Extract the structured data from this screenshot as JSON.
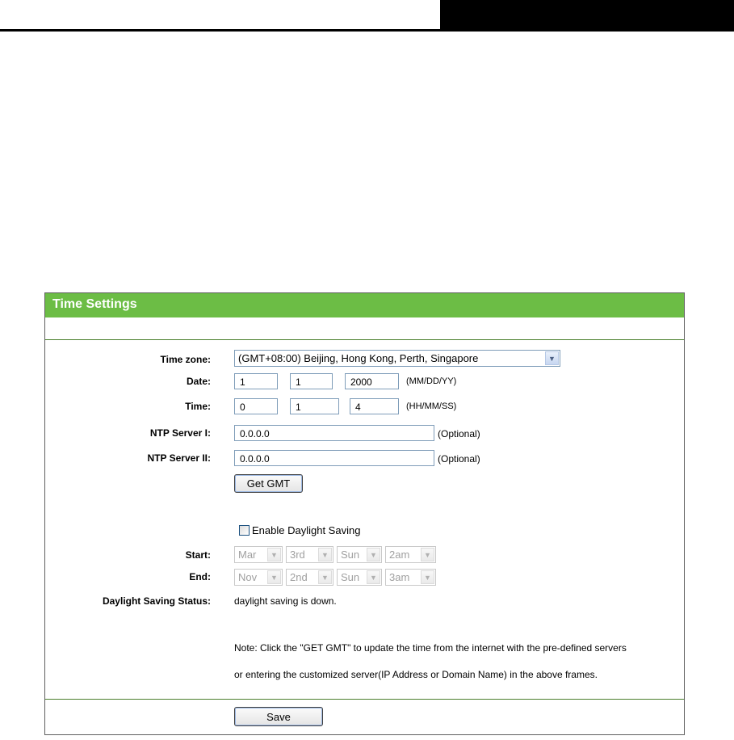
{
  "panel": {
    "title": "Time Settings"
  },
  "form": {
    "time_zone": {
      "label": "Time zone:",
      "value": "(GMT+08:00) Beijing, Hong Kong, Perth, Singapore"
    },
    "date": {
      "label": "Date:",
      "month": "1",
      "day": "1",
      "year": "2000",
      "hint": "(MM/DD/YY)"
    },
    "time": {
      "label": "Time:",
      "hour": "0",
      "minute": "1",
      "second": "4",
      "hint": "(HH/MM/SS)"
    },
    "ntp1": {
      "label": "NTP Server I:",
      "value": "0.0.0.0",
      "hint": "(Optional)"
    },
    "ntp2": {
      "label": "NTP Server II:",
      "value": "0.0.0.0",
      "hint": "(Optional)"
    },
    "get_gmt_label": "Get GMT",
    "daylight": {
      "checkbox_label": "Enable Daylight Saving",
      "checked": false
    },
    "start": {
      "label": "Start:",
      "month": "Mar",
      "week": "3rd",
      "day": "Sun",
      "hour": "2am"
    },
    "end": {
      "label": "End:",
      "month": "Nov",
      "week": "2nd",
      "day": "Sun",
      "hour": "3am"
    },
    "status": {
      "label": "Daylight Saving Status:",
      "value": "daylight saving is down."
    },
    "note_line1": "Note: Click the \"GET GMT\" to update the time from the internet with the pre-defined servers",
    "note_line2": "or entering the customized server(IP Address or Domain Name) in the above frames.",
    "save_label": "Save"
  },
  "colors": {
    "header_green": "#6cbd45",
    "separator": "#4a7f2c"
  },
  "icons": {
    "dropdown_arrow": "chevron-down-icon"
  }
}
